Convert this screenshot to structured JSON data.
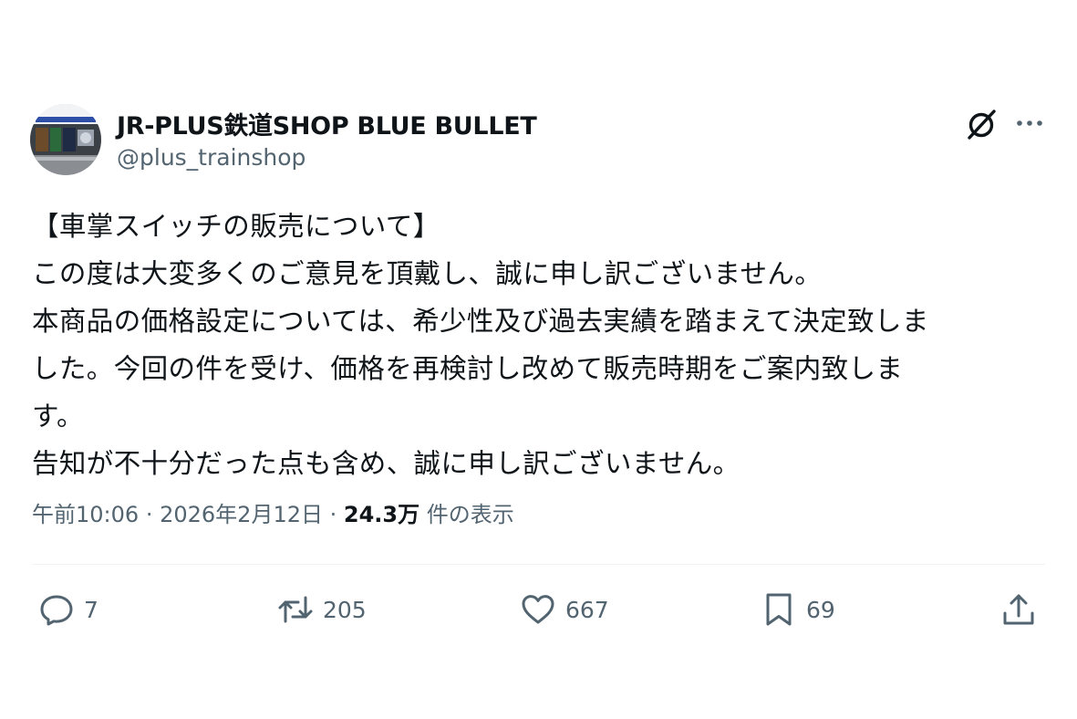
{
  "author": {
    "display_name": "JR-PLUS鉄道SHOP BLUE BULLET",
    "handle": "@plus_trainshop"
  },
  "tweet": {
    "lines": [
      "【車掌スイッチの販売について】",
      "この度は大変多くのご意見を頂戴し、誠に申し訳ございません。",
      "本商品の価格設定については、希少性及び過去実績を踏まえて決定致しま",
      "した。今回の件を受け、価格を再検討し改めて販売時期をご案内致しま",
      "す。",
      "告知が不十分だった点も含め、誠に申し訳ございません。"
    ]
  },
  "meta": {
    "time": "午前10:06",
    "separator": "·",
    "date": "2026年2月12日",
    "views_count": "24.3万",
    "views_label": "件の表示"
  },
  "actions": {
    "replies": "7",
    "reposts": "205",
    "likes": "667",
    "bookmarks": "69"
  },
  "icons": {
    "grok": "grok-icon",
    "more": "more-icon",
    "reply": "reply-icon",
    "repost": "repost-icon",
    "like": "heart-icon",
    "bookmark": "bookmark-icon",
    "share": "share-icon"
  },
  "colors": {
    "text": "#0f1419",
    "secondary": "#536471",
    "divider": "#eff3f4"
  }
}
